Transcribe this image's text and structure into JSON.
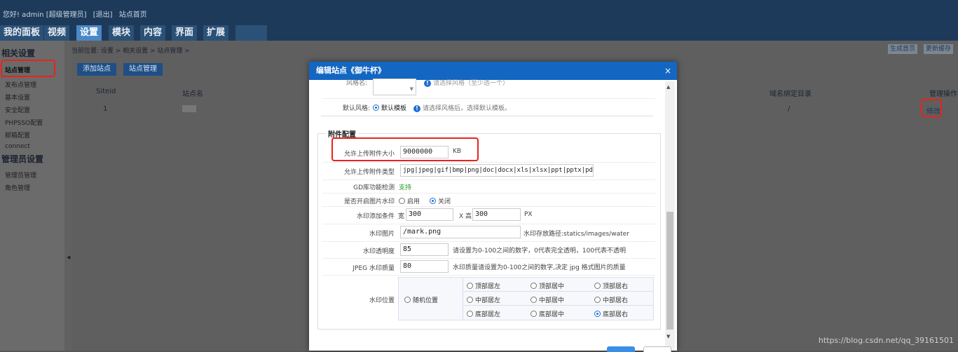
{
  "topbar": {
    "greeting": "您好! admin [超级管理员]",
    "logout": "[退出]",
    "site_home": "站点首页",
    "tabs": [
      "我的面板",
      "视频",
      "设置",
      "模块",
      "内容",
      "界面",
      "扩展"
    ],
    "active_tab": "设置"
  },
  "sidebar": {
    "section1": "相关设置",
    "items1": [
      "站点管理",
      "发布点管理",
      "基本设置",
      "安全配置",
      "PHPSSO配置",
      "邮箱配置",
      "connect"
    ],
    "section2": "管理员设置",
    "items2": [
      "管理员管理",
      "角色管理"
    ]
  },
  "main": {
    "breadcrumb": "当前位置: 设置 > 相关设置 > 站点管理 >",
    "btn_add": "添加站点",
    "btn_manage": "站点管理",
    "btn_gen_home": "生成首页",
    "btn_update_cache": "更新缓存",
    "table": {
      "headers": [
        "Siteid",
        "站点名",
        "域名绑定目录",
        "管理操作"
      ],
      "rows": [
        {
          "siteid": "1",
          "dir": "/",
          "action": "修改"
        }
      ]
    }
  },
  "dialog": {
    "title": "编辑站点《御牛杯》",
    "close": "×",
    "style_label": "风格名:",
    "style_tip": "请选择风格（至少选一个）",
    "default_style_label": "默认风格:",
    "default_style_value": "默认模板",
    "default_style_tip": "请选择风格后，选择默认模板。",
    "attach_legend": "附件配置",
    "fields": {
      "upload_size_label": "允许上传附件大小",
      "upload_size_value": "9000000",
      "upload_size_unit": "KB",
      "upload_type_label": "允许上传附件类型",
      "upload_type_value": "jpg|jpeg|gif|bmp|png|doc|docx|xls|xlsx|ppt|pptx|pdf|txt|rar",
      "gd_label": "GD库功能检测",
      "gd_value": "支持",
      "watermark_enable_label": "是否开启图片水印",
      "watermark_on": "启用",
      "watermark_off": "关闭",
      "watermark_cond_label": "水印添加条件",
      "width_label": "宽",
      "width_value": "300",
      "height_label": "X 高",
      "height_value": "300",
      "px_unit": "PX",
      "watermark_img_label": "水印图片",
      "watermark_img_value": "/mark.png",
      "watermark_img_tip": "水印存放路径:statics/images/water",
      "opacity_label": "水印透明度",
      "opacity_value": "85",
      "opacity_tip": "请设置为0-100之间的数字，0代表完全透明，100代表不透明",
      "jpeg_label": "JPEG 水印质量",
      "jpeg_value": "80",
      "jpeg_tip": "水印质量请设置为0-100之间的数字,决定 jpg 格式图片的质量",
      "position_label": "水印位置",
      "position_random": "随机位置",
      "positions": [
        "顶部居左",
        "顶部居中",
        "顶部居右",
        "中部居左",
        "中部居中",
        "中部居右",
        "底部居左",
        "底部居中",
        "底部居右"
      ],
      "position_selected": "底部居右"
    }
  },
  "watermark_url": "https://blog.csdn.net/qq_39161501",
  "colors": {
    "accent": "#1366c2",
    "highlight": "#e8231c",
    "topbar": "#1d3a5a"
  }
}
